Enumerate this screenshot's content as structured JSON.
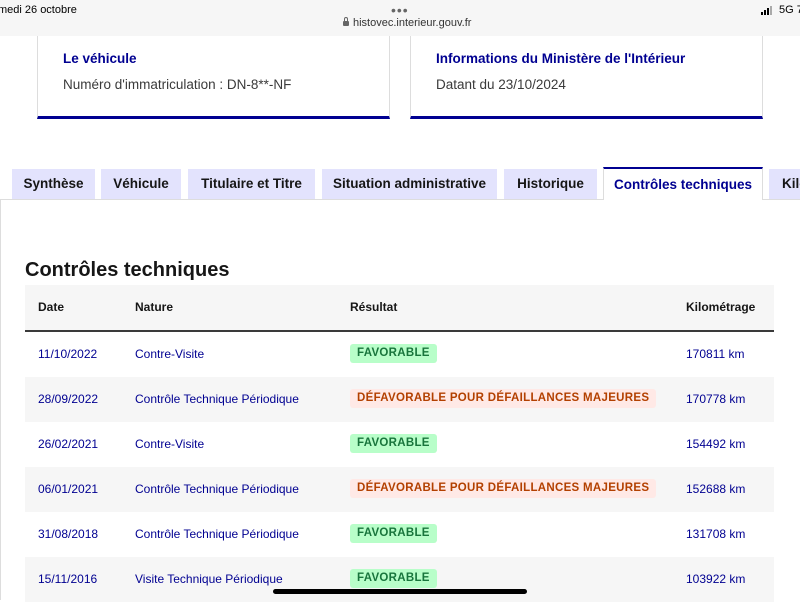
{
  "statusbar": {
    "date": "medi 26 octobre",
    "dots": "•••",
    "url": "histovec.interieur.gouv.fr",
    "network": "5G 7"
  },
  "cards": {
    "vehicle": {
      "title": "Le véhicule",
      "text": "Numéro d'immatriculation : DN-8**-NF"
    },
    "ministry": {
      "title": "Informations du Ministère de l'Intérieur",
      "text": "Datant du 23/10/2024"
    }
  },
  "tabs": [
    {
      "label": "Synthèse",
      "active": false
    },
    {
      "label": "Véhicule",
      "active": false
    },
    {
      "label": "Titulaire et Titre",
      "active": false
    },
    {
      "label": "Situation administrative",
      "active": false
    },
    {
      "label": "Historique",
      "active": false
    },
    {
      "label": "Contrôles techniques",
      "active": true
    },
    {
      "label": "Kilométrage",
      "active": false
    }
  ],
  "section_title": "Contrôles techniques",
  "table": {
    "headers": {
      "date": "Date",
      "nature": "Nature",
      "result": "Résultat",
      "km": "Kilométrage"
    },
    "rows": [
      {
        "date": "11/10/2022",
        "nature": "Contre-Visite",
        "result": "FAVORABLE",
        "status": "favorable",
        "km": "170811 km"
      },
      {
        "date": "28/09/2022",
        "nature": "Contrôle Technique Périodique",
        "result": "DÉFAVORABLE POUR DÉFAILLANCES MAJEURES",
        "status": "defavorable",
        "km": "170778 km"
      },
      {
        "date": "26/02/2021",
        "nature": "Contre-Visite",
        "result": "FAVORABLE",
        "status": "favorable",
        "km": "154492 km"
      },
      {
        "date": "06/01/2021",
        "nature": "Contrôle Technique Périodique",
        "result": "DÉFAVORABLE POUR DÉFAILLANCES MAJEURES",
        "status": "defavorable",
        "km": "152688 km"
      },
      {
        "date": "31/08/2018",
        "nature": "Contrôle Technique Périodique",
        "result": "FAVORABLE",
        "status": "favorable",
        "km": "131708 km"
      },
      {
        "date": "15/11/2016",
        "nature": "Visite Technique Périodique",
        "result": "FAVORABLE",
        "status": "favorable",
        "km": "103922 km"
      }
    ]
  },
  "colors": {
    "primary": "#000091",
    "tab_bg": "#e3e3fd",
    "favorable_bg": "#b8fec9",
    "favorable_text": "#18753c",
    "defavorable_bg": "#ffe9e6",
    "defavorable_text": "#b34000"
  }
}
